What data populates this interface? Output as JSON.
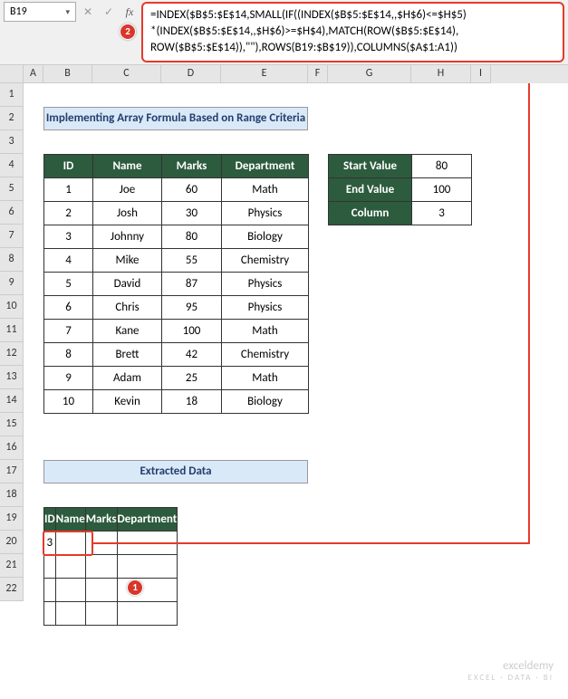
{
  "namebox": "B19",
  "formula": {
    "line1": "=INDEX($B$5:$E$14,SMALL(IF((INDEX($B$5:$E$14,,$H$6)<=$H$5)",
    "line2": "*(INDEX($B$5:$E$14,,$H$6)>=$H$4),MATCH(ROW($B$5:$E$14),",
    "line3": "ROW($B$5:$E$14)),\"\"),ROWS(B19:$B$19)),COLUMNS($A$1:A1))"
  },
  "cols": {
    "A": "A",
    "B": "B",
    "C": "C",
    "D": "D",
    "E": "E",
    "F": "F",
    "G": "G",
    "H": "H",
    "I": "I"
  },
  "title": "Implementing Array Formula Based on Range Criteria",
  "headers": {
    "id": "ID",
    "name": "Name",
    "marks": "Marks",
    "dept": "Department"
  },
  "rows": [
    {
      "id": "1",
      "name": "Joe",
      "marks": "60",
      "dept": "Math"
    },
    {
      "id": "2",
      "name": "Josh",
      "marks": "30",
      "dept": "Physics"
    },
    {
      "id": "3",
      "name": "Johnny",
      "marks": "80",
      "dept": "Biology"
    },
    {
      "id": "4",
      "name": "Mike",
      "marks": "55",
      "dept": "Chemistry"
    },
    {
      "id": "5",
      "name": "David",
      "marks": "87",
      "dept": "Physics"
    },
    {
      "id": "6",
      "name": "Chris",
      "marks": "95",
      "dept": "Physics"
    },
    {
      "id": "7",
      "name": "Kane",
      "marks": "100",
      "dept": "Math"
    },
    {
      "id": "8",
      "name": "Brett",
      "marks": "42",
      "dept": "Chemistry"
    },
    {
      "id": "9",
      "name": "Adam",
      "marks": "25",
      "dept": "Math"
    },
    {
      "id": "10",
      "name": "Kevin",
      "marks": "18",
      "dept": "Biology"
    }
  ],
  "criteria": {
    "start_lbl": "Start Value",
    "start_val": "80",
    "end_lbl": "End Value",
    "end_val": "100",
    "col_lbl": "Column",
    "col_val": "3"
  },
  "extract_title": "Extracted Data",
  "extract_result": "3",
  "badges": {
    "one": "1",
    "two": "2"
  },
  "watermark": {
    "brand": "exceldemy",
    "tag": "EXCEL · DATA · BI"
  }
}
